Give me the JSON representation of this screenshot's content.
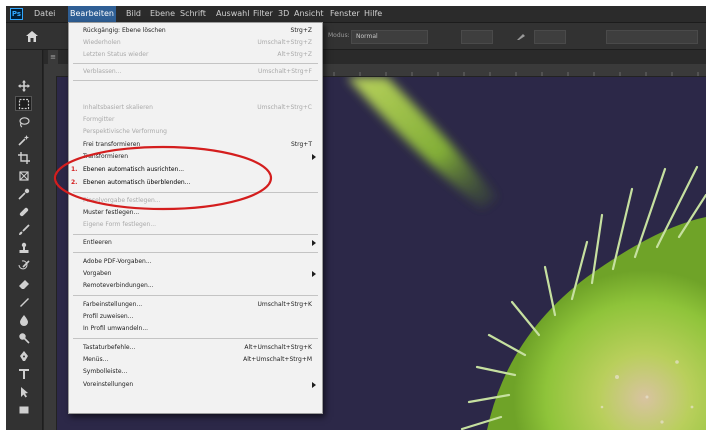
{
  "menubar": {
    "logo": "Ps",
    "items": [
      "Datei",
      "Bearbeiten",
      "Bild",
      "Ebene",
      "Schrift",
      "Auswahl",
      "Filter",
      "3D",
      "Ansicht",
      "Fenster",
      "Hilfe"
    ]
  },
  "options": {
    "mode_value": "Normal",
    "mode_label": "Modus:"
  },
  "colors": {
    "accent": "#2f5f95",
    "callout": "#d41e1e",
    "canvas_bg": "#2c2848",
    "leaf": "#8fc43a"
  },
  "edit_menu": {
    "items": [
      {
        "label": "Rückgängig: Ebene löschen",
        "shortcut": "Strg+Z",
        "disabled": false
      },
      {
        "label": "Wiederholen",
        "shortcut": "Umschalt+Strg+Z",
        "disabled": true
      },
      {
        "label": "Letzten Status wieder",
        "shortcut": "Alt+Strg+Z",
        "disabled": true
      },
      {
        "sep": true
      },
      {
        "label": "Verblassen...",
        "shortcut": "Umschalt+Strg+F",
        "disabled": true
      },
      {
        "sep": true
      },
      {
        "label": "Inhaltsbasiert skalieren",
        "shortcut": "Umschalt+Strg+C",
        "disabled": true
      },
      {
        "label": "Formgitter",
        "shortcut": "",
        "disabled": true
      },
      {
        "label": "Perspektivische Verformung",
        "shortcut": "",
        "disabled": true
      },
      {
        "label": "Frei transformieren",
        "shortcut": "Strg+T",
        "disabled": false
      },
      {
        "label": "Transformieren",
        "shortcut": "",
        "disabled": false,
        "submenu": true
      },
      {
        "label": "Ebenen automatisch ausrichten...",
        "shortcut": "",
        "disabled": false,
        "annot": "1."
      },
      {
        "label": "Ebenen automatisch überblenden...",
        "shortcut": "",
        "disabled": false,
        "annot": "2."
      },
      {
        "sep": true
      },
      {
        "label": "Pinselvorgabe festlegen...",
        "shortcut": "",
        "disabled": true
      },
      {
        "label": "Muster festlegen...",
        "shortcut": "",
        "disabled": false
      },
      {
        "label": "Eigene Form festlegen...",
        "shortcut": "",
        "disabled": true
      },
      {
        "sep": true
      },
      {
        "label": "Entleeren",
        "shortcut": "",
        "disabled": false,
        "submenu": true
      },
      {
        "sep": true
      },
      {
        "label": "Adobe PDF-Vorgaben...",
        "shortcut": "",
        "disabled": false
      },
      {
        "label": "Vorgaben",
        "shortcut": "",
        "disabled": false,
        "submenu": true
      },
      {
        "label": "Remoteverbindungen...",
        "shortcut": "",
        "disabled": false
      },
      {
        "sep": true
      },
      {
        "label": "Farbeinstellungen...",
        "shortcut": "Umschalt+Strg+K",
        "disabled": false
      },
      {
        "label": "Profil zuweisen...",
        "shortcut": "",
        "disabled": false
      },
      {
        "label": "In Profil umwandeln...",
        "shortcut": "",
        "disabled": false
      },
      {
        "sep": true
      },
      {
        "label": "Tastaturbefehle...",
        "shortcut": "Alt+Umschalt+Strg+K",
        "disabled": false
      },
      {
        "label": "Menüs...",
        "shortcut": "Alt+Umschalt+Strg+M",
        "disabled": false
      },
      {
        "label": "Symbolleiste...",
        "shortcut": "",
        "disabled": false
      },
      {
        "label": "Voreinstellungen",
        "shortcut": "",
        "disabled": false,
        "submenu": true
      }
    ]
  },
  "toolbar": {
    "tools": [
      "move-icon",
      "marquee-icon",
      "lasso-icon",
      "magic-wand-icon",
      "crop-icon",
      "frame-icon",
      "eyedropper-icon",
      "healing-brush-icon",
      "brush-icon",
      "clone-stamp-icon",
      "history-brush-icon",
      "eraser-icon",
      "gradient-icon",
      "blur-icon",
      "dodge-icon",
      "pen-icon",
      "type-icon",
      "path-selection-icon",
      "rectangle-icon"
    ]
  }
}
